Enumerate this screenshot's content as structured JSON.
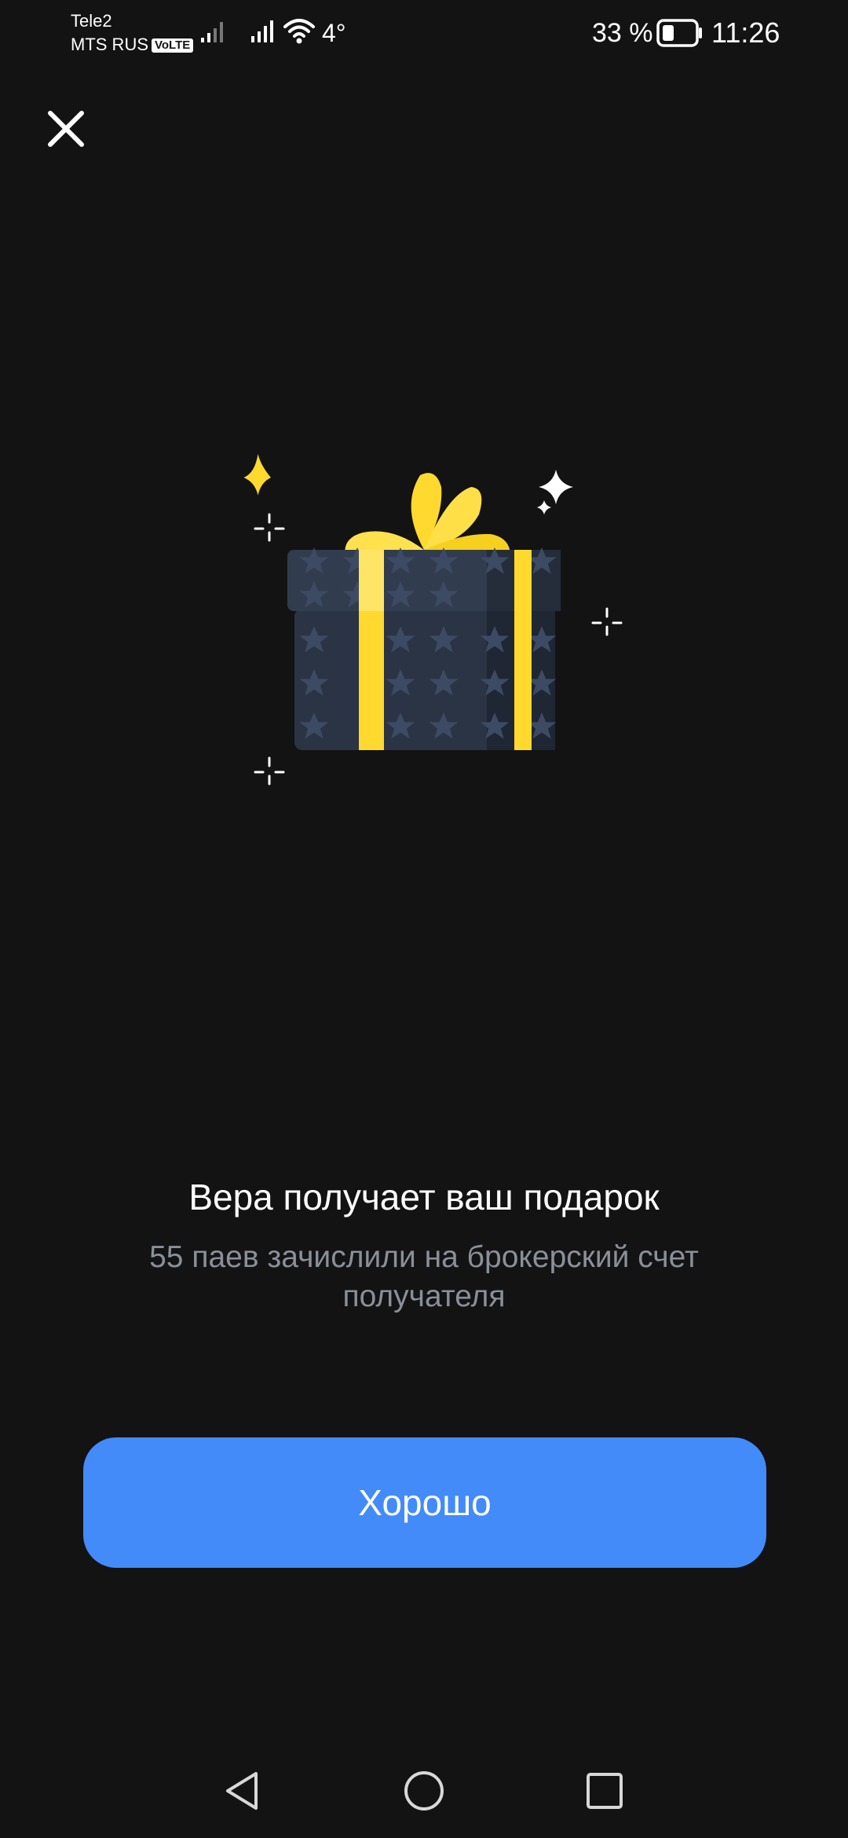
{
  "status_bar": {
    "carrier_1": "Tele2",
    "carrier_2": "MTS RUS",
    "volte_badge": "VoLTE",
    "temperature": "4°",
    "battery_percent": "33 %",
    "time": "11:26"
  },
  "close_icon": "close-icon",
  "message": {
    "title": "Вера получает ваш подарок",
    "subtitle": "55 паев зачислили на брокерский счет получателя"
  },
  "ok_button": {
    "label": "Хорошо"
  },
  "colors": {
    "background": "#131314",
    "accent": "#428bf9",
    "subtitle": "#8a8f99",
    "ribbon": "#ffd92e",
    "gift_box": "#2b3444"
  },
  "nav_bar": {
    "back_icon": "triangle-back-icon",
    "home_icon": "circle-home-icon",
    "recents_icon": "square-recents-icon"
  }
}
